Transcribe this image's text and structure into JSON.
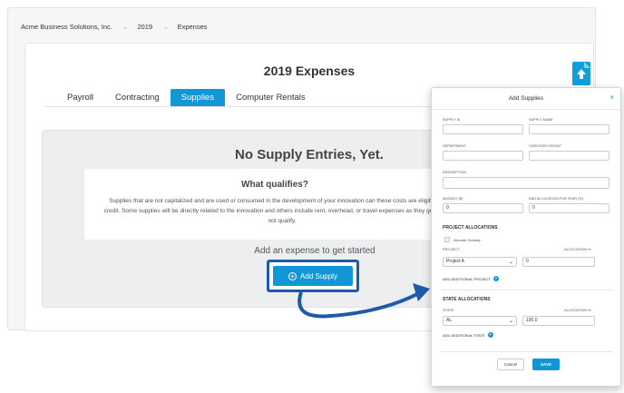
{
  "breadcrumb": {
    "company": "Acme Business Solutions, Inc.",
    "sep": "→",
    "year": "2019",
    "section": "Expenses"
  },
  "page": {
    "title": "2019 Expenses"
  },
  "tabs": [
    {
      "label": "Payroll"
    },
    {
      "label": "Contracting"
    },
    {
      "label": "Supplies"
    },
    {
      "label": "Computer Rentals"
    }
  ],
  "empty": {
    "title": "No Supply Entries, Yet.",
    "qual_title": "What qualifies?",
    "qual_text": "Supplies that are not capitalized and are used or consumed in the development of your innovation can these costs are eligible for the credit. Some supplies will be directly related to the innovation and others include rent, overhead, or travel expenses as they generally will not qualify.",
    "add_prompt": "Add an expense to get started",
    "add_button": "Add Supply"
  },
  "modal": {
    "title": "Add Supplies",
    "close": "×",
    "supply_id_label": "SUPPLY ID",
    "supply_name_label": "SUPPLY NAME",
    "department_label": "DEPARTMENT",
    "category_label": "CATEGORY/GROUP",
    "description_label": "DESCRIPTION",
    "amount_label": "AMOUNT ($)",
    "amount_value": "0",
    "rnd_label": "R&D ALLOCATION FOR YEAR (%)",
    "rnd_value": "0",
    "project_section": "PROJECT ALLOCATIONS",
    "allocate_globally": "Allocate Globally",
    "project_col": "PROJECT",
    "allocation_col": "ALLOCATION %",
    "project_value": "Project A",
    "project_alloc_value": "0",
    "add_project": "ADD ADDITIONAL PROJECT",
    "state_section": "STATE ALLOCATIONS",
    "state_col": "STATE",
    "state_alloc_col": "ALLOCATION %",
    "state_value": "AL",
    "state_alloc_value": "100.0",
    "add_state": "ADD ADDITIONAL STATE",
    "cancel": "Cancel",
    "save": "SAVE"
  },
  "colors": {
    "accent": "#1197d6",
    "highlight": "#1e5aa8"
  }
}
